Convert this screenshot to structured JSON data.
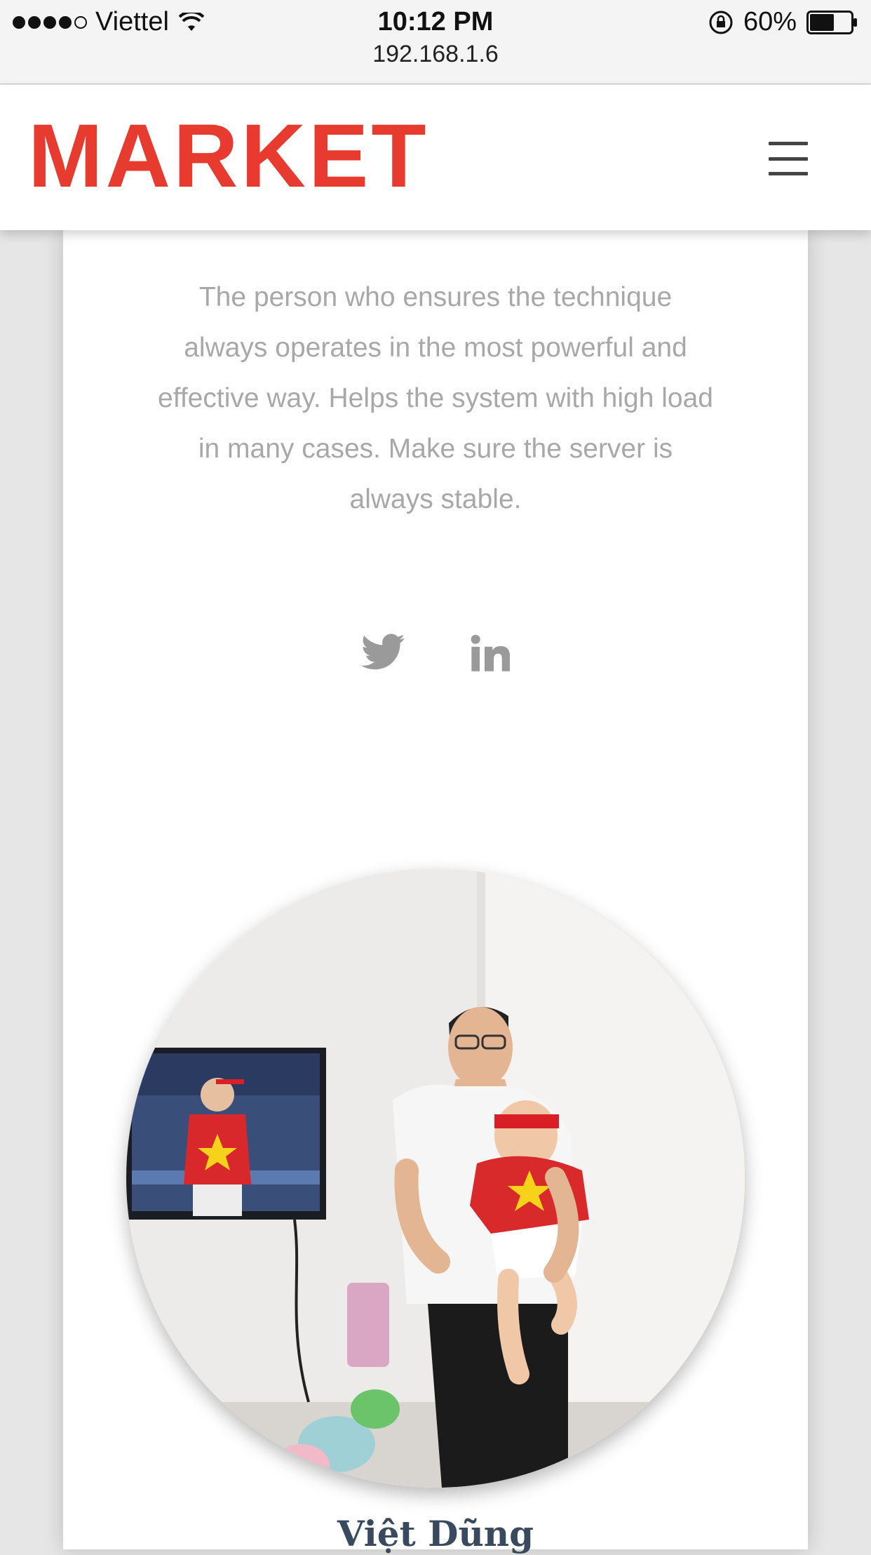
{
  "status_bar": {
    "carrier": "Viettel",
    "time": "10:12 PM",
    "battery": "60%",
    "battery_level": 0.6,
    "signal_bars_filled": 4,
    "signal_bars_total": 5
  },
  "browser": {
    "address": "192.168.1.6"
  },
  "header": {
    "logo": "MARKET",
    "logo_color": "#e63b2e",
    "menu_icon": "hamburger-menu-icon"
  },
  "profile": {
    "bio": "The person who ensures the technique always operates in the most powerful and effective way. Helps the system with high load in many cases. Make sure the server is always stable.",
    "socials": [
      {
        "icon": "twitter-icon"
      },
      {
        "icon": "linkedin-icon"
      }
    ],
    "photo_icon": "profile-photo",
    "name": "Việt Dũng"
  },
  "colors": {
    "text_muted": "#a8a8a8",
    "icon_gray": "#9a9a9a",
    "name_color": "#3a4a5e",
    "page_bg": "#e6e6e6"
  }
}
